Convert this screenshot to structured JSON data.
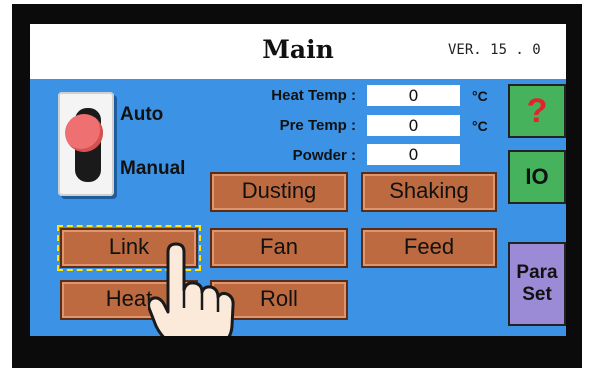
{
  "header": {
    "title": "Main",
    "version": "VER. 15 . 0"
  },
  "mode_switch": {
    "auto_label": "Auto",
    "manual_label": "Manual",
    "state": "Auto"
  },
  "readings": [
    {
      "label": "Heat Temp :",
      "value": "0",
      "unit": "°C"
    },
    {
      "label": "Pre Temp :",
      "value": "0",
      "unit": "°C"
    },
    {
      "label": "Powder :",
      "value": "0",
      "unit": ""
    }
  ],
  "buttons": {
    "dusting": "Dusting",
    "shaking": "Shaking",
    "link": "Link",
    "fan": "Fan",
    "feed": "Feed",
    "heat": "Heat",
    "roll": "Roll"
  },
  "side_buttons": {
    "help": "?",
    "io": "IO",
    "para_set_line1": "Para",
    "para_set_line2": "Set"
  },
  "colors": {
    "screen_bg": "#3c93e6",
    "button_fill": "#bd6a40",
    "help_io_fill": "#46b35c",
    "paraset_fill": "#9b8bd6",
    "selected_outline": "#ffe700"
  },
  "overlay": {
    "icon": "pointing-hand-icon",
    "target": "link"
  }
}
